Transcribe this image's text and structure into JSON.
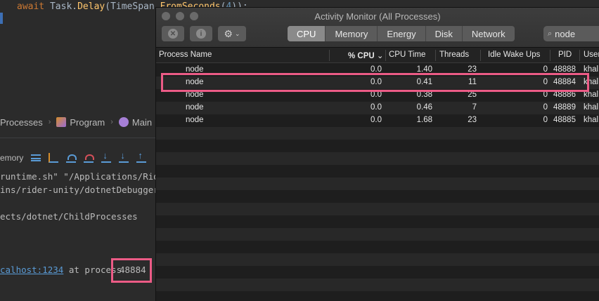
{
  "ide": {
    "code_line": {
      "await": "await",
      "task": "Task.",
      "delay": "Delay",
      "open": "(",
      "timespan": "TimeSpan.",
      "fromseconds": "FromSeconds",
      "paren_open": "(",
      "number": "4",
      "close": "));"
    },
    "breadcrumbs": [
      {
        "label": "Processes"
      },
      {
        "label": "Program"
      },
      {
        "label": "Main"
      }
    ],
    "toolbar_label": "emory",
    "console_lines": [
      "runtime.sh\" \"/Applications/Ride",
      "ins/rider-unity/dotnetDebuggerWo",
      "ects/dotnet/ChildProcesses"
    ],
    "attach_link": "calhost:1234",
    "attach_text": " at process",
    "attach_pid": "48884"
  },
  "activity_monitor": {
    "title": "Activity Monitor (All Processes)",
    "tabs": [
      {
        "label": "CPU",
        "active": true
      },
      {
        "label": "Memory",
        "active": false
      },
      {
        "label": "Energy",
        "active": false
      },
      {
        "label": "Disk",
        "active": false
      },
      {
        "label": "Network",
        "active": false
      }
    ],
    "search_value": "node",
    "columns": {
      "name": "Process Name",
      "cpu": "% CPU",
      "cpu_sort": "⌄",
      "cpu_time": "CPU Time",
      "threads": "Threads",
      "idle_wake": "Idle Wake Ups",
      "pid": "PID",
      "user": "User"
    },
    "rows": [
      {
        "name": "node",
        "cpu": "0.0",
        "cpu_time": "1.40",
        "threads": "23",
        "idle": "0",
        "pid": "48888",
        "user": "khal"
      },
      {
        "name": "node",
        "cpu": "0.0",
        "cpu_time": "0.41",
        "threads": "11",
        "idle": "0",
        "pid": "48884",
        "user": "khal"
      },
      {
        "name": "node",
        "cpu": "0.0",
        "cpu_time": "0.38",
        "threads": "25",
        "idle": "0",
        "pid": "48886",
        "user": "khal"
      },
      {
        "name": "node",
        "cpu": "0.0",
        "cpu_time": "0.46",
        "threads": "7",
        "idle": "0",
        "pid": "48889",
        "user": "khal"
      },
      {
        "name": "node",
        "cpu": "0.0",
        "cpu_time": "1.68",
        "threads": "23",
        "idle": "0",
        "pid": "48885",
        "user": "khal"
      }
    ],
    "empty_row_count": 14
  }
}
